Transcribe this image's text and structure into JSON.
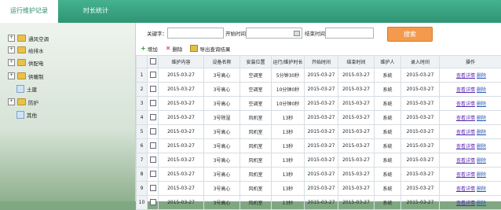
{
  "tabs": [
    {
      "label": "运行维护记录"
    },
    {
      "label": "时长统计"
    }
  ],
  "tree": [
    {
      "label": "通风空调",
      "type": "folder"
    },
    {
      "label": "给排水",
      "type": "folder"
    },
    {
      "label": "供配电",
      "type": "folder"
    },
    {
      "label": "供暖制",
      "type": "folder"
    },
    {
      "label": "土建",
      "type": "doc"
    },
    {
      "label": "防护",
      "type": "folder"
    },
    {
      "label": "其他",
      "type": "doc"
    }
  ],
  "filters": {
    "keyword_label": "关键字：",
    "start_label": "开始时间",
    "end_label": "结束时间",
    "search_label": "搜索"
  },
  "toolbar": {
    "add": "增加",
    "delete": "删除",
    "export": "导出查询结果"
  },
  "columns": [
    "",
    "",
    "维护内容",
    "设备名称",
    "安装位置",
    "运行/维护时长",
    "开始时间",
    "结束时间",
    "维护人",
    "录入时间",
    "操作"
  ],
  "actions": {
    "view": "查看详情",
    "del": "删除"
  },
  "rows": [
    {
      "n": "1",
      "content": "2015-03-27",
      "device": "3号高心",
      "loc": "空调室",
      "dur": "5分钟30秒",
      "start": "2015-03-27",
      "end": "2015-03-27",
      "person": "系统",
      "time": "2015-03-27"
    },
    {
      "n": "2",
      "content": "2015-03-27",
      "device": "3号高心",
      "loc": "空调室",
      "dur": "10分钟0秒",
      "start": "2015-03-27",
      "end": "2015-03-27",
      "person": "系统",
      "time": "2015-03-27"
    },
    {
      "n": "3",
      "content": "2015-03-27",
      "device": "3号高心",
      "loc": "空调室",
      "dur": "10分钟0秒",
      "start": "2015-03-27",
      "end": "2015-03-27",
      "person": "系统",
      "time": "2015-03-27"
    },
    {
      "n": "4",
      "content": "2015-03-27",
      "device": "3号除湿",
      "loc": "风机室",
      "dur": "13秒",
      "start": "2015-03-27",
      "end": "2015-03-27",
      "person": "系统",
      "time": "2015-03-27"
    },
    {
      "n": "5",
      "content": "2015-03-27",
      "device": "3号高心",
      "loc": "风机室",
      "dur": "13秒",
      "start": "2015-03-27",
      "end": "2015-03-27",
      "person": "系统",
      "time": "2015-03-27"
    },
    {
      "n": "6",
      "content": "2015-03-27",
      "device": "3号高心",
      "loc": "风机室",
      "dur": "13秒",
      "start": "2015-03-27",
      "end": "2015-03-27",
      "person": "系统",
      "time": "2015-03-27"
    },
    {
      "n": "7",
      "content": "2015-03-27",
      "device": "3号高心",
      "loc": "风机室",
      "dur": "13秒",
      "start": "2015-03-27",
      "end": "2015-03-27",
      "person": "系统",
      "time": "2015-03-27"
    },
    {
      "n": "8",
      "content": "2015-03-27",
      "device": "3号高心",
      "loc": "风机室",
      "dur": "13秒",
      "start": "2015-03-27",
      "end": "2015-03-27",
      "person": "系统",
      "time": "2015-03-27"
    },
    {
      "n": "9",
      "content": "2015-03-27",
      "device": "3号高心",
      "loc": "风机室",
      "dur": "13秒",
      "start": "2015-03-27",
      "end": "2015-03-27",
      "person": "系统",
      "time": "2015-03-27"
    },
    {
      "n": "10",
      "content": "2015-03-27",
      "device": "3号高心",
      "loc": "风机室",
      "dur": "13秒",
      "start": "2015-03-27",
      "end": "2015-03-27",
      "person": "系统",
      "time": "2015-03-27"
    }
  ]
}
